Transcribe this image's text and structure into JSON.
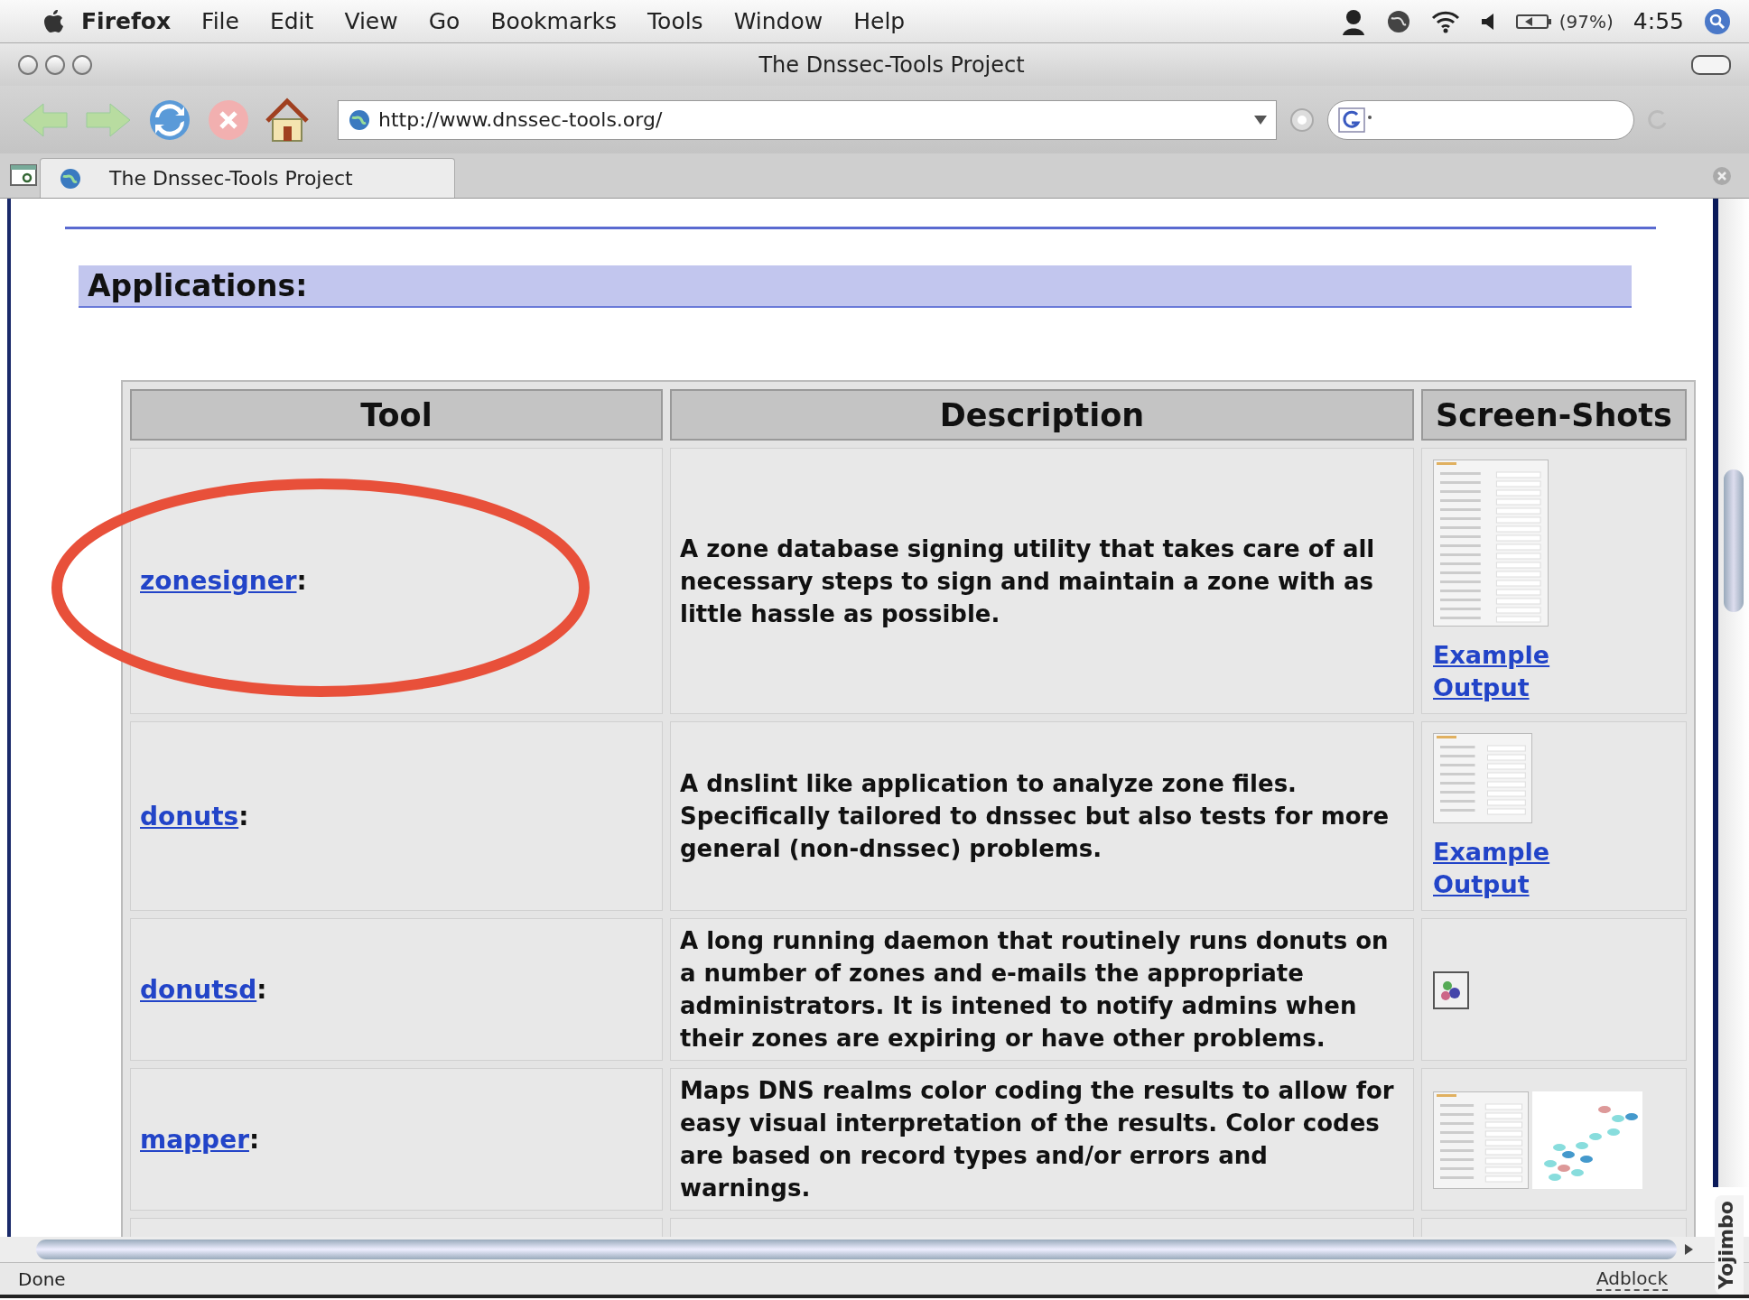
{
  "menu_bar": {
    "app": "Firefox",
    "menus": [
      "File",
      "Edit",
      "View",
      "Go",
      "Bookmarks",
      "Tools",
      "Window",
      "Help"
    ],
    "battery": "(97%)",
    "clock": "4:55"
  },
  "window": {
    "title": "The Dnssec-Tools Project"
  },
  "toolbar": {
    "url": "http://www.dnssec-tools.org/"
  },
  "tabs": [
    {
      "label": "The Dnssec-Tools Project",
      "selected": true
    }
  ],
  "page": {
    "heading": "Applications:",
    "table": {
      "columns": [
        "Tool",
        "Description",
        "Screen-Shots"
      ],
      "rows": [
        {
          "tool": {
            "link": "zonesigner",
            "after": ":"
          },
          "circled": true,
          "description": "A zone database signing utility that takes care of all necessary steps to sign and maintain a zone with as little hassle as possible.",
          "shots": [
            {
              "kind": "dialog"
            }
          ],
          "link": "Example Output"
        },
        {
          "tool": {
            "link": "donuts",
            "after": ":"
          },
          "circled": false,
          "description": "A dnslint like application to analyze zone files. Specifically tailored to dnssec but also tests for more general (non-dnssec) problems.",
          "shots": [
            {
              "kind": "small_dialog"
            }
          ],
          "link": "Example Output"
        },
        {
          "tool": {
            "link": "donutsd",
            "after": ":"
          },
          "circled": false,
          "description": "A long running daemon that routinely runs donuts on a number of zones and e-mails the appropriate administrators. It is intened to notify admins when their zones are expiring or have other problems.",
          "shots": [
            {
              "kind": "broken"
            }
          ]
        },
        {
          "tool": {
            "link": "mapper",
            "after": ":"
          },
          "circled": false,
          "description": "Maps DNS realms color coding the results to allow for easy visual interpretation of the results. Color codes are based on record types and/or errors and warnings.",
          "shots": [
            {
              "kind": "dialog_short"
            },
            {
              "kind": "graph"
            }
          ]
        }
      ]
    }
  },
  "status_bar": {
    "text": "Done",
    "adblock": "Adblock",
    "sidebar_tab": "Yojimbo"
  }
}
